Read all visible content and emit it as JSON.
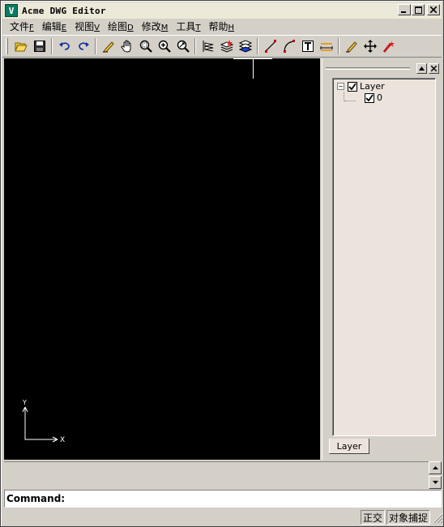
{
  "window": {
    "title": "Acme DWG Editor",
    "icon_letter": "V",
    "controls": {
      "minimize": "minimize-icon",
      "maximize": "maximize-icon",
      "close": "close-icon"
    }
  },
  "menu": [
    {
      "label": "文件",
      "accel": "F"
    },
    {
      "label": "编辑",
      "accel": "E"
    },
    {
      "label": "视图",
      "accel": "V"
    },
    {
      "label": "绘图",
      "accel": "D"
    },
    {
      "label": "修改",
      "accel": "M"
    },
    {
      "label": "工具",
      "accel": "T"
    },
    {
      "label": "帮助",
      "accel": "H"
    }
  ],
  "toolbar": {
    "groups": [
      [
        "open-icon",
        "save-icon"
      ],
      [
        "undo-icon",
        "redo-icon"
      ],
      [
        "pencil-icon",
        "pan-icon",
        "zoom-window-icon",
        "zoom-in-icon",
        "zoom-realtime-icon"
      ],
      [
        "layer-properties-icon",
        "layer-new-icon",
        "layer-state-icon"
      ],
      [
        "line-icon",
        "arc-icon",
        "text-icon",
        "dimension-icon"
      ],
      [
        "eraser-icon",
        "move-icon",
        "explode-icon"
      ]
    ]
  },
  "layer_panel": {
    "tree_root": "Layer",
    "layers": [
      "0"
    ],
    "tab_label": "Layer"
  },
  "ucs": {
    "x_label": "X",
    "y_label": "Y"
  },
  "command": {
    "label": "Command:",
    "value": ""
  },
  "status": {
    "ortho": "正交",
    "osnap": "对象捕捉"
  },
  "colors": {
    "canvas_bg": "#000000",
    "chrome": "#d4d0c8",
    "panel_bg": "#ece4dc"
  }
}
